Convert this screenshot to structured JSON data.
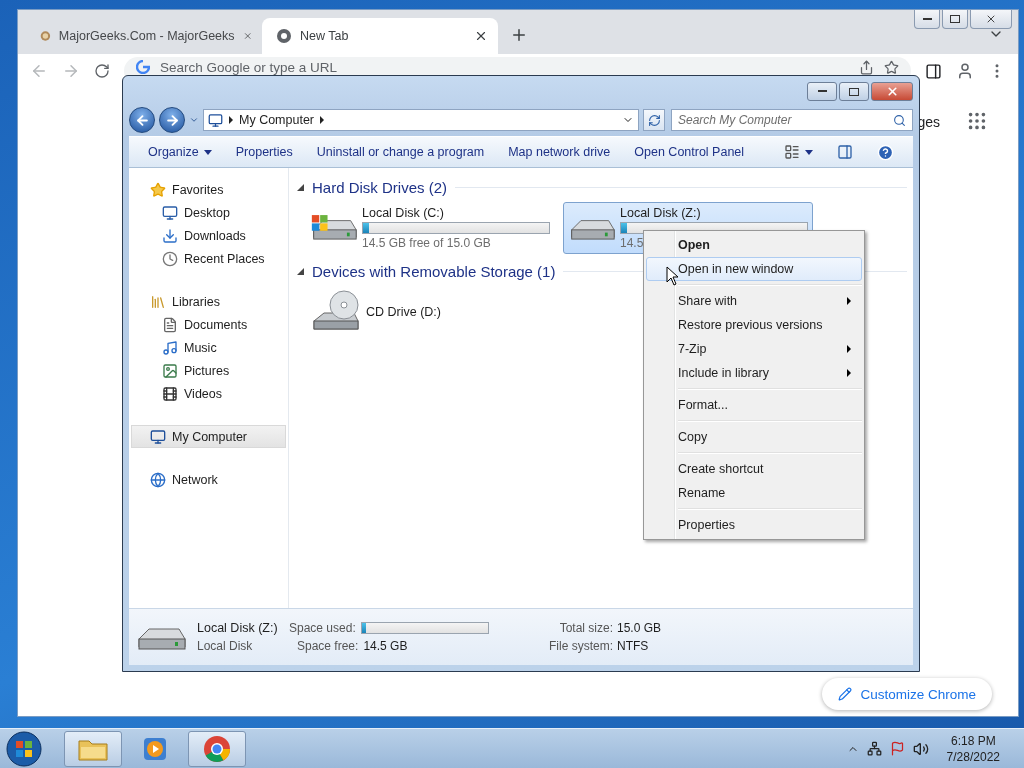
{
  "browser": {
    "tabs": [
      {
        "title": "MajorGeeks.Com - MajorGeeks",
        "selected": false
      },
      {
        "title": "New Tab",
        "selected": true
      }
    ],
    "omnibox": {
      "placeholder": "Search Google or type a URL"
    },
    "apps_link": "ges",
    "customize_button": "Customize Chrome"
  },
  "explorer": {
    "address": [
      "My Computer"
    ],
    "search": {
      "placeholder": "Search My Computer"
    },
    "toolbar": [
      "Organize",
      "Properties",
      "Uninstall or change a program",
      "Map network drive",
      "Open Control Panel"
    ],
    "navigation": [
      {
        "label": "Favorites",
        "kind": "star",
        "selected": false,
        "children": [
          {
            "label": "Desktop",
            "kind": "desktop",
            "selected": false
          },
          {
            "label": "Downloads",
            "kind": "downloads",
            "selected": false
          },
          {
            "label": "Recent Places",
            "kind": "recent",
            "selected": false
          }
        ]
      },
      {
        "label": "Libraries",
        "kind": "library",
        "selected": false,
        "children": [
          {
            "label": "Documents",
            "kind": "documents",
            "selected": false
          },
          {
            "label": "Music",
            "kind": "music",
            "selected": false
          },
          {
            "label": "Pictures",
            "kind": "pictures",
            "selected": false
          },
          {
            "label": "Videos",
            "kind": "videos",
            "selected": false
          }
        ]
      },
      {
        "label": "My Computer",
        "kind": "computer",
        "selected": true
      },
      {
        "label": "Network",
        "kind": "network",
        "selected": false
      }
    ],
    "sections": [
      {
        "title": "Hard Disk Drives (2)",
        "drives": [
          {
            "name": "Local Disk (C:)",
            "kind": "system-disk",
            "level": 0.03,
            "free": "14.5 GB free of 15.0 GB",
            "selected": false
          },
          {
            "name": "Local Disk (Z:)",
            "kind": "disk",
            "level": 0.03,
            "free": "14.5",
            "selected": true
          }
        ]
      },
      {
        "title": "Devices with Removable Storage (1)",
        "drives": [
          {
            "name": "CD Drive (D:)",
            "kind": "cd",
            "selected": false
          }
        ]
      }
    ],
    "details": {
      "name": "Local Disk (Z:)",
      "type": "Local Disk",
      "used_label": "Space used:",
      "level": 0.03,
      "free_label": "Space free:",
      "free": "14.5 GB",
      "total_label": "Total size:",
      "total": "15.0 GB",
      "fs_label": "File system:",
      "fs": "NTFS"
    }
  },
  "context_menu": [
    {
      "kind": "item",
      "label": "Open",
      "default": true,
      "submenu": false,
      "selected": false
    },
    {
      "kind": "item",
      "label": "Open in new window",
      "default": false,
      "submenu": false,
      "selected": true
    },
    {
      "kind": "separator"
    },
    {
      "kind": "item",
      "label": "Share with",
      "default": false,
      "submenu": true,
      "selected": false
    },
    {
      "kind": "item",
      "label": "Restore previous versions",
      "default": false,
      "submenu": false,
      "selected": false
    },
    {
      "kind": "item",
      "label": "7-Zip",
      "default": false,
      "submenu": true,
      "selected": false
    },
    {
      "kind": "item",
      "label": "Include in library",
      "default": false,
      "submenu": true,
      "selected": false
    },
    {
      "kind": "separator"
    },
    {
      "kind": "item",
      "label": "Format...",
      "default": false,
      "submenu": false,
      "selected": false
    },
    {
      "kind": "separator"
    },
    {
      "kind": "item",
      "label": "Copy",
      "default": false,
      "submenu": false,
      "selected": false
    },
    {
      "kind": "separator"
    },
    {
      "kind": "item",
      "label": "Create shortcut",
      "default": false,
      "submenu": false,
      "selected": false
    },
    {
      "kind": "item",
      "label": "Rename",
      "default": false,
      "submenu": false,
      "selected": false
    },
    {
      "kind": "separator"
    },
    {
      "kind": "item",
      "label": "Properties",
      "default": false,
      "submenu": false,
      "selected": false
    }
  ],
  "taskbar": {
    "buttons": [
      {
        "kind": "explorer",
        "running": true
      },
      {
        "kind": "media",
        "running": false
      },
      {
        "kind": "browser",
        "running": true
      }
    ],
    "time": "6:18 PM",
    "date": "7/28/2022"
  }
}
